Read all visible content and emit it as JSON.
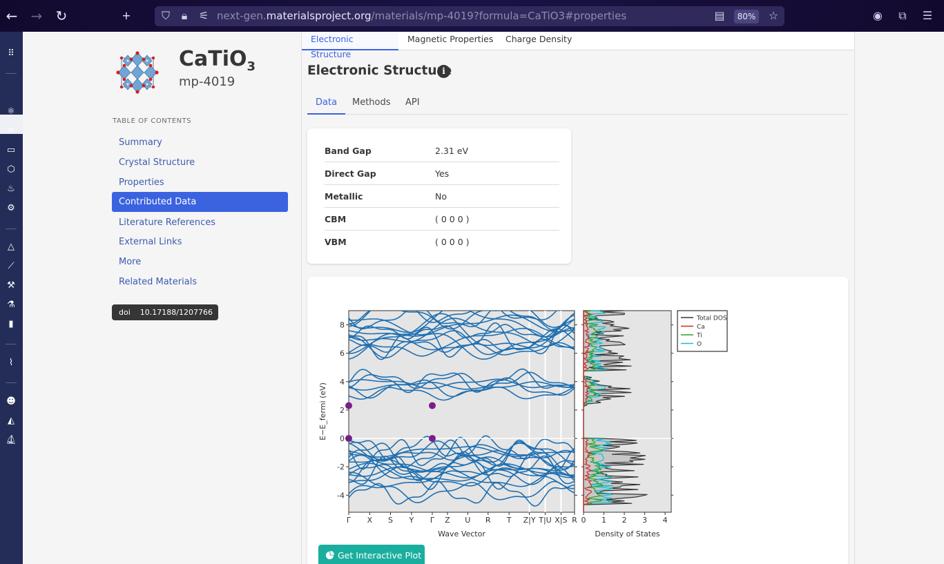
{
  "browser": {
    "url_prefix": "next-gen.",
    "url_host": "materialsproject.org",
    "url_path": "/materials/mp-4019?formula=CaTiO3#properties",
    "zoom": "80%"
  },
  "material": {
    "formula_main": "CaTiO",
    "formula_sub": "3",
    "id": "mp-4019"
  },
  "toc": {
    "heading": "TABLE OF CONTENTS",
    "items": [
      {
        "label": "Summary"
      },
      {
        "label": "Crystal Structure"
      },
      {
        "label": "Properties"
      },
      {
        "label": "Contributed Data"
      },
      {
        "label": "Literature References"
      },
      {
        "label": "External Links"
      },
      {
        "label": "More"
      },
      {
        "label": "Related Materials"
      }
    ],
    "doi_label": "doi",
    "doi_value": "10.17188/1207766"
  },
  "top_tabs": [
    "Electronic Structure",
    "Magnetic Properties",
    "Charge Density"
  ],
  "section": {
    "title": "Electronic Structure",
    "info": "i",
    "sub_tabs": [
      "Data",
      "Methods",
      "API"
    ]
  },
  "properties": [
    {
      "label": "Band Gap",
      "value": "2.31 eV"
    },
    {
      "label": "Direct Gap",
      "value": "Yes"
    },
    {
      "label": "Metallic",
      "value": "No"
    },
    {
      "label": "CBM",
      "value": "( 0 0 0 )"
    },
    {
      "label": "VBM",
      "value": "( 0 0 0 )"
    }
  ],
  "button": {
    "interactive_plot": "Get Interactive Plot"
  },
  "colors": {
    "band": "#1f6fb0",
    "total_dos": "#333333",
    "ca": "#d62728",
    "ti": "#2ca02c",
    "o": "#17becf",
    "extrema": "#7a1f8a",
    "accent": "#3b63e0",
    "button": "#1aae9f"
  },
  "chart_data": [
    {
      "type": "line",
      "title": "",
      "xlabel": "Wave Vector",
      "ylabel": "E−E_fermi (eV)",
      "ylim": [
        -5.2,
        9
      ],
      "x_ticks": [
        "Γ",
        "X",
        "S",
        "Y",
        "Γ",
        "Z",
        "U",
        "R",
        "T",
        "Z|Y",
        "T|U",
        "X|S",
        "R"
      ],
      "y_ticks": [
        -4,
        -2,
        0,
        2,
        4,
        6,
        8
      ],
      "grid": false,
      "band_gap_eV": 2.31,
      "extrema_points": [
        {
          "k": "Γ",
          "energy": 2.31,
          "kind": "CBM"
        },
        {
          "k": "Γ",
          "energy": 2.31,
          "kind": "CBM"
        },
        {
          "k": "Γ",
          "energy": 0,
          "kind": "VBM"
        },
        {
          "k": "Γ",
          "energy": 0,
          "kind": "VBM"
        }
      ]
    },
    {
      "type": "area",
      "xlabel": "Density of States",
      "xlim": [
        0,
        4.3
      ],
      "x_ticks": [
        0,
        1,
        2,
        3,
        4
      ],
      "series": [
        {
          "name": "Total DOS"
        },
        {
          "name": "Ca"
        },
        {
          "name": "Ti"
        },
        {
          "name": "O"
        }
      ],
      "legend": "right"
    }
  ]
}
